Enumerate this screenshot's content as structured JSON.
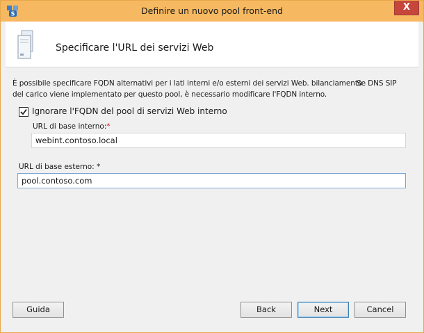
{
  "window": {
    "title": "Definire un nuovo pool front-end",
    "close_label": "X"
  },
  "header": {
    "title": "Specificare l'URL dei servizi Web"
  },
  "description": {
    "line1": "È possibile specificare FQDN alternativi per i lati interni e/o esterni dei servizi Web. bilanciamento",
    "line1_right": "Se DNS SIP",
    "line2": "del carico viene implementato per questo pool, è necessario modificare l'FQDN interno."
  },
  "override_checkbox": {
    "label": "Ignorare l'FQDN del pool di servizi Web interno",
    "checked": true
  },
  "internal_url": {
    "label": "URL di base interno:",
    "required_mark": "*",
    "value": "webint.contoso.local"
  },
  "external_url": {
    "label": "URL di base esterno: ",
    "required_mark": "*",
    "value": "pool.contoso.com"
  },
  "buttons": {
    "help": "Guida",
    "back": "Back",
    "next": "Next",
    "cancel": "Cancel"
  },
  "colors": {
    "titlebar": "#f6b860",
    "close": "#c7463c",
    "accent_border": "#3c7fb1"
  }
}
